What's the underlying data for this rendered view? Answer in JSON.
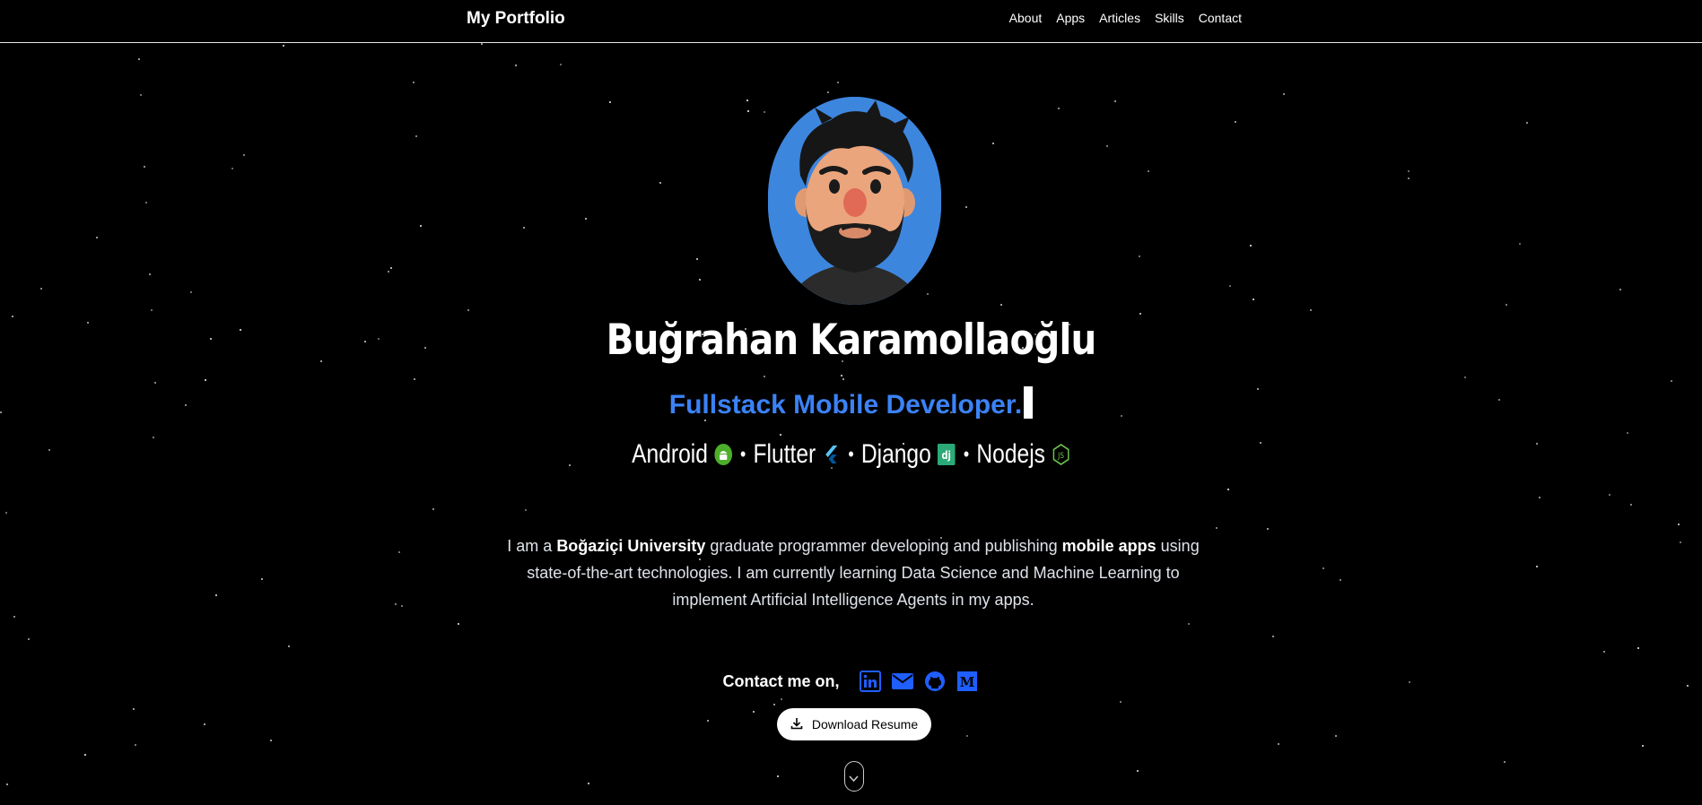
{
  "nav": {
    "brand": "My Portfolio",
    "links": [
      "About",
      "Apps",
      "Articles",
      "Skills",
      "Contact"
    ]
  },
  "hero": {
    "name": "Buğrahan Karamollaoğlu",
    "subtitle": "Fullstack Mobile Developer.",
    "tech": [
      {
        "label": "Android",
        "icon": "android-icon"
      },
      {
        "label": "Flutter",
        "icon": "flutter-icon"
      },
      {
        "label": "Django",
        "icon": "django-icon"
      },
      {
        "label": "Nodejs",
        "icon": "nodejs-icon"
      }
    ],
    "separator": "•"
  },
  "bio": {
    "p1": "I am a ",
    "university": "Boğaziçi University",
    "p2": " graduate programmer developing and publishing ",
    "mobile": "mobile apps",
    "p3": " using state-of-the-art technologies. I am currently learning Data Science and Machine Learning to implement Artificial Intelligence Agents in my apps."
  },
  "contact": {
    "label": "Contact me on,",
    "socials": [
      "linkedin-icon",
      "mail-icon",
      "github-icon",
      "medium-icon"
    ]
  },
  "resume": {
    "label": "Download Resume"
  },
  "colors": {
    "background": "#000000",
    "accent": "#3b82f6",
    "social_blue": "#1f5eff",
    "avatar_bg": "#3d86de"
  }
}
